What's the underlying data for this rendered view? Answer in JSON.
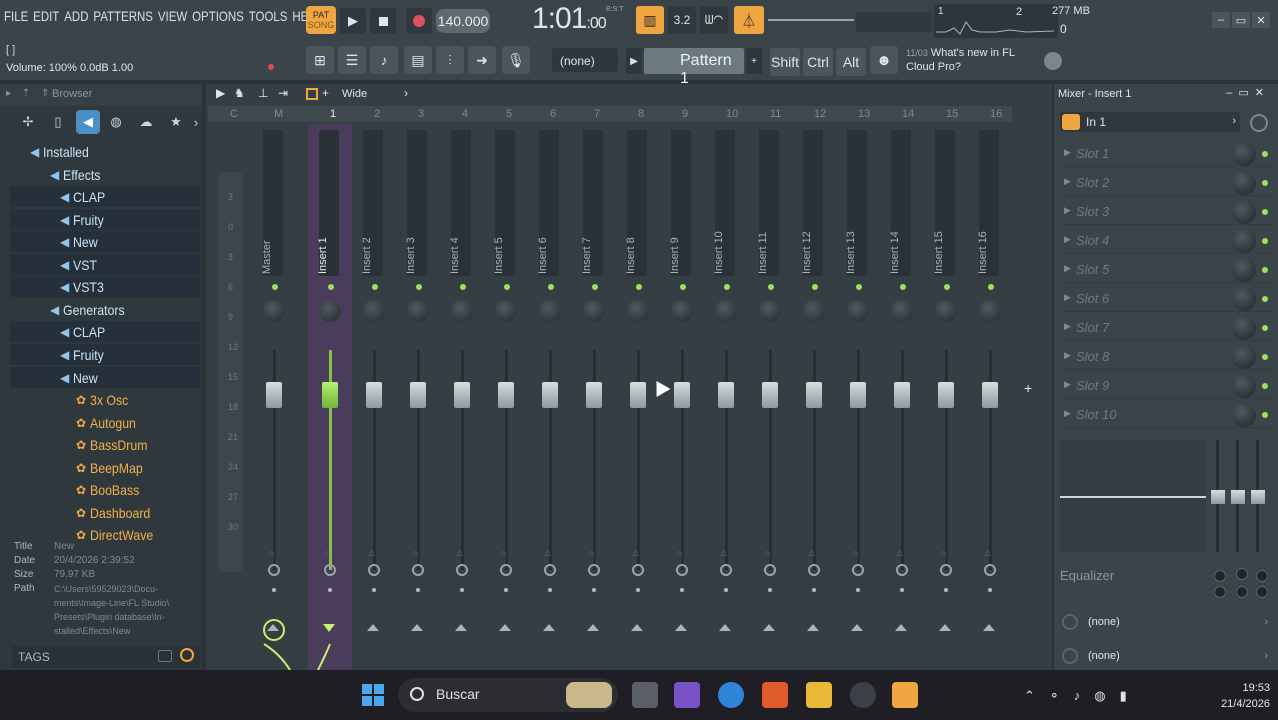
{
  "menu": [
    "FILE",
    "EDIT",
    "ADD",
    "PATTERNS",
    "VIEW",
    "OPTIONS",
    "TOOLS",
    "HELP"
  ],
  "hint": "[ ]",
  "volume_line": "Volume: 100%  0.0dB  1.00",
  "transport": {
    "pat_label": "PAT",
    "song_label": "SONG",
    "tempo": "140.000",
    "time_main": "1:01",
    "time_small": ":00",
    "time_sub": "B:S:T"
  },
  "toolbar_icons": [
    "piano-roll-icon",
    "step-32-icon",
    "wave-icon",
    "metronome-icon"
  ],
  "icon_labels": {
    "step32": "3.2",
    "wave": "ᗯ◠"
  },
  "cpu": "2",
  "mem": "277 MB",
  "mem_sub": "0",
  "cpu_left": "1",
  "pattern": {
    "none_label": "(none)",
    "name": "Pattern 1"
  },
  "mod_keys": [
    "Shift",
    "Ctrl",
    "Alt"
  ],
  "news": {
    "date": "11/03",
    "line1": "What's new in FL",
    "line2": "Cloud Pro?"
  },
  "browser": {
    "title": "Browser",
    "tree": [
      {
        "label": "Installed",
        "type": "folder",
        "level": 0
      },
      {
        "label": "Effects",
        "type": "folder",
        "level": 1
      },
      {
        "label": "CLAP",
        "type": "folder",
        "level": 2
      },
      {
        "label": "Fruity",
        "type": "folder",
        "level": 2
      },
      {
        "label": "New",
        "type": "folder",
        "level": 2
      },
      {
        "label": "VST",
        "type": "folder",
        "level": 2
      },
      {
        "label": "VST3",
        "type": "folder",
        "level": 2
      },
      {
        "label": "Generators",
        "type": "folder",
        "level": 1
      },
      {
        "label": "CLAP",
        "type": "folder",
        "level": 2
      },
      {
        "label": "Fruity",
        "type": "folder",
        "level": 2
      },
      {
        "label": "New",
        "type": "folder",
        "level": 2
      },
      {
        "label": "3x Osc",
        "type": "plugin",
        "level": 3
      },
      {
        "label": "Autogun",
        "type": "plugin",
        "level": 3
      },
      {
        "label": "BassDrum",
        "type": "plugin",
        "level": 3
      },
      {
        "label": "BeepMap",
        "type": "plugin",
        "level": 3
      },
      {
        "label": "BooBass",
        "type": "plugin",
        "level": 3
      },
      {
        "label": "Dashboard",
        "type": "plugin",
        "level": 3
      },
      {
        "label": "DirectWave",
        "type": "plugin",
        "level": 3
      }
    ],
    "info": {
      "title_k": "Title",
      "title_v": "New",
      "date_k": "Date",
      "date_v": "20/4/2026 2:39:52",
      "size_k": "Size",
      "size_v": "79.97 KB",
      "path_k": "Path",
      "path_lines": [
        "C:\\Users\\59529023\\Docu-",
        "ments\\Image-Line\\FL Studio\\",
        "Presets\\Plugin database\\In-",
        "stalled\\Effects\\New"
      ]
    },
    "tags_label": "TAGS"
  },
  "mixer": {
    "head_label": "Wide",
    "numbers": [
      "C",
      "M",
      "1",
      "2",
      "3",
      "4",
      "5",
      "6",
      "7",
      "8",
      "9",
      "10",
      "11",
      "12",
      "13",
      "14",
      "15",
      "16"
    ],
    "strips": [
      "Master",
      "Insert 1",
      "Insert 2",
      "Insert 3",
      "Insert 4",
      "Insert 5",
      "Insert 6",
      "Insert 7",
      "Insert 8",
      "Insert 9",
      "Insert 10",
      "Insert 11",
      "Insert 12",
      "Insert 13",
      "Insert 14",
      "Insert 15",
      "Insert 16"
    ],
    "selected": "Insert 1",
    "meter_scale": [
      "3",
      "0",
      "3",
      "6",
      "9",
      "12",
      "15",
      "18",
      "21",
      "24",
      "27",
      "30"
    ]
  },
  "insert_panel": {
    "title": "Mixer - Insert 1",
    "input": "In 1",
    "slots": [
      "Slot 1",
      "Slot 2",
      "Slot 3",
      "Slot 4",
      "Slot 5",
      "Slot 6",
      "Slot 7",
      "Slot 8",
      "Slot 9",
      "Slot 10"
    ],
    "eq_label": "Equalizer",
    "out1": "(none)",
    "out2": "(none)"
  },
  "taskbar": {
    "search": "Buscar",
    "time": "19:53",
    "date": "21/4/2026"
  },
  "colors": {
    "accent": "#f0a640",
    "selected_strip": "#4a3d5c",
    "led": "#9be35a",
    "plugin_text": "#f3b04a",
    "folder_icon": "#8fc6ef"
  }
}
